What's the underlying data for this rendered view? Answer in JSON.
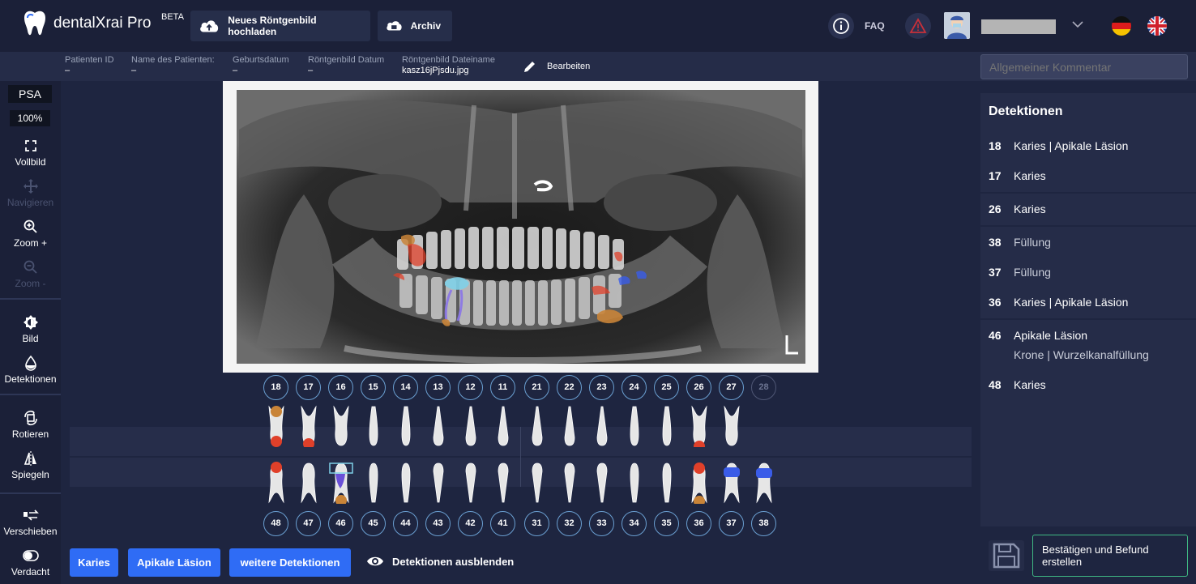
{
  "app": {
    "brand": "dentalXrai Pro",
    "beta": "BETA"
  },
  "topbar": {
    "upload_label": "Neues Röntgenbild hochladen",
    "archive_label": "Archiv",
    "faq_label": "FAQ"
  },
  "infobar": {
    "fields": [
      {
        "label": "Patienten ID",
        "value": "–"
      },
      {
        "label": "Name des Patienten:",
        "value": "–"
      },
      {
        "label": "Geburtsdatum",
        "value": "–"
      },
      {
        "label": "Röntgenbild Datum",
        "value": "–"
      },
      {
        "label": "Röntgenbild Dateiname",
        "value": "kasz16jPjsdu.jpg"
      }
    ],
    "edit_label": "Bearbeiten",
    "comment_placeholder": "Allgemeiner Kommentar"
  },
  "tools": {
    "mode": "PSA",
    "zoom": "100%",
    "fullscreen": "Vollbild",
    "navigate": "Navigieren",
    "zoom_in": "Zoom +",
    "zoom_out": "Zoom -",
    "image": "Bild",
    "detections": "Detektionen",
    "rotate": "Rotieren",
    "mirror": "Spiegeln",
    "shift": "Verschieben",
    "suspicion": "Verdacht"
  },
  "xray": {
    "side_marker": "L"
  },
  "teeth": {
    "upper": [
      "18",
      "17",
      "16",
      "15",
      "14",
      "13",
      "12",
      "11",
      "21",
      "22",
      "23",
      "24",
      "25",
      "26",
      "27",
      "28"
    ],
    "lower": [
      "48",
      "47",
      "46",
      "45",
      "44",
      "43",
      "42",
      "41",
      "31",
      "32",
      "33",
      "34",
      "35",
      "36",
      "37",
      "38"
    ]
  },
  "bottom": {
    "caries": "Karies",
    "apical": "Apikale Läsion",
    "more": "weitere Detektionen",
    "hide": "Detektionen ausblenden"
  },
  "detections": {
    "title": "Detektionen",
    "items": [
      {
        "tooth": "18",
        "text": "Karies | Apikale Läsion",
        "sub": ""
      },
      {
        "tooth": "17",
        "text": "Karies",
        "sub": ""
      },
      {
        "tooth": "26",
        "text": "Karies",
        "sub": ""
      },
      {
        "tooth": "38",
        "text": "Füllung",
        "sub": ""
      },
      {
        "tooth": "37",
        "text": "Füllung",
        "sub": ""
      },
      {
        "tooth": "36",
        "text": "Karies | Apikale Läsion",
        "sub": ""
      },
      {
        "tooth": "46",
        "text": "Apikale Läsion",
        "sub": "Krone | Wurzelkanalfüllung"
      },
      {
        "tooth": "48",
        "text": "Karies",
        "sub": ""
      }
    ]
  },
  "confirm_label": "Bestätigen und Befund erstellen",
  "colors": {
    "caries": "#e0402a",
    "apical": "#c98438",
    "filling": "#3a5ce8",
    "crown": "#7fd0e8",
    "accent": "#2f6cf5",
    "confirm_border": "#3fb883"
  }
}
